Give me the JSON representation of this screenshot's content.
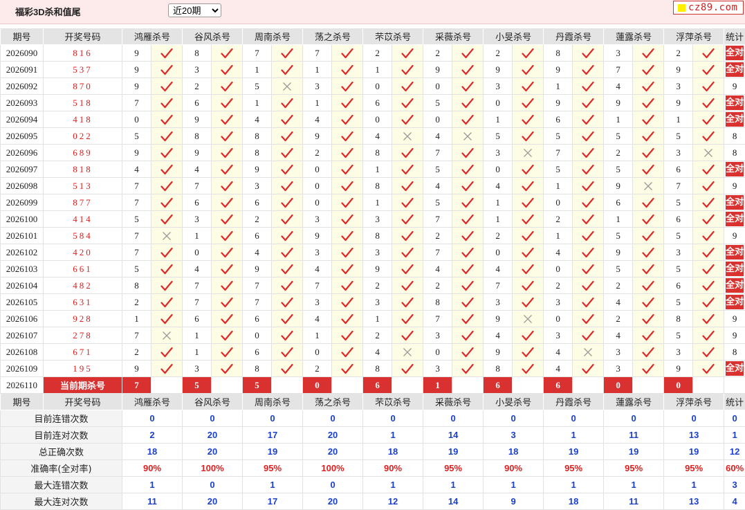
{
  "header": {
    "title": "福彩3D杀和值尾",
    "period_select": {
      "value": "近20期",
      "options": [
        "近20期"
      ]
    },
    "logo_text": "cz89.com"
  },
  "columns": {
    "issue": "期号",
    "winning": "开奖号码",
    "experts": [
      "鸿雁杀号",
      "谷风杀号",
      "周南杀号",
      "荡之杀号",
      "芣苡杀号",
      "采薇杀号",
      "小旻杀号",
      "丹霞杀号",
      "蓮露杀号",
      "浮萍杀号"
    ],
    "stat": "统计"
  },
  "rows": [
    {
      "issue": "2026090",
      "win": "816",
      "kills": [
        "9",
        "8",
        "7",
        "7",
        "2",
        "2",
        "2",
        "8",
        "3",
        "2"
      ],
      "ok": [
        1,
        1,
        1,
        1,
        1,
        1,
        1,
        1,
        1,
        1
      ],
      "stat": "全对"
    },
    {
      "issue": "2026091",
      "win": "537",
      "kills": [
        "9",
        "3",
        "1",
        "1",
        "1",
        "9",
        "9",
        "9",
        "7",
        "9"
      ],
      "ok": [
        1,
        1,
        1,
        1,
        1,
        1,
        1,
        1,
        1,
        1
      ],
      "stat": "全对"
    },
    {
      "issue": "2026092",
      "win": "870",
      "kills": [
        "9",
        "2",
        "5",
        "3",
        "0",
        "0",
        "3",
        "1",
        "4",
        "3"
      ],
      "ok": [
        1,
        1,
        0,
        1,
        1,
        1,
        1,
        1,
        1,
        1
      ],
      "stat": "9"
    },
    {
      "issue": "2026093",
      "win": "518",
      "kills": [
        "7",
        "6",
        "1",
        "1",
        "6",
        "5",
        "0",
        "9",
        "9",
        "9"
      ],
      "ok": [
        1,
        1,
        1,
        1,
        1,
        1,
        1,
        1,
        1,
        1
      ],
      "stat": "全对"
    },
    {
      "issue": "2026094",
      "win": "418",
      "kills": [
        "0",
        "9",
        "4",
        "4",
        "0",
        "0",
        "1",
        "6",
        "1",
        "1"
      ],
      "ok": [
        1,
        1,
        1,
        1,
        1,
        1,
        1,
        1,
        1,
        1
      ],
      "stat": "全对"
    },
    {
      "issue": "2026095",
      "win": "022",
      "kills": [
        "5",
        "8",
        "8",
        "9",
        "4",
        "4",
        "5",
        "5",
        "5",
        "5"
      ],
      "ok": [
        1,
        1,
        1,
        1,
        0,
        0,
        1,
        1,
        1,
        1
      ],
      "stat": "8"
    },
    {
      "issue": "2026096",
      "win": "689",
      "kills": [
        "9",
        "9",
        "8",
        "2",
        "8",
        "7",
        "3",
        "7",
        "2",
        "3"
      ],
      "ok": [
        1,
        1,
        1,
        1,
        1,
        1,
        0,
        1,
        1,
        0
      ],
      "stat": "8"
    },
    {
      "issue": "2026097",
      "win": "818",
      "kills": [
        "4",
        "4",
        "9",
        "0",
        "1",
        "5",
        "0",
        "5",
        "5",
        "6"
      ],
      "ok": [
        1,
        1,
        1,
        1,
        1,
        1,
        1,
        1,
        1,
        1
      ],
      "stat": "全对"
    },
    {
      "issue": "2026098",
      "win": "513",
      "kills": [
        "7",
        "7",
        "3",
        "0",
        "8",
        "4",
        "4",
        "1",
        "9",
        "7"
      ],
      "ok": [
        1,
        1,
        1,
        1,
        1,
        1,
        1,
        1,
        0,
        1
      ],
      "stat": "9"
    },
    {
      "issue": "2026099",
      "win": "877",
      "kills": [
        "7",
        "6",
        "6",
        "0",
        "1",
        "5",
        "1",
        "0",
        "6",
        "5"
      ],
      "ok": [
        1,
        1,
        1,
        1,
        1,
        1,
        1,
        1,
        1,
        1
      ],
      "stat": "全对"
    },
    {
      "issue": "2026100",
      "win": "414",
      "kills": [
        "5",
        "3",
        "2",
        "3",
        "3",
        "7",
        "1",
        "2",
        "1",
        "6"
      ],
      "ok": [
        1,
        1,
        1,
        1,
        1,
        1,
        1,
        1,
        1,
        1
      ],
      "stat": "全对"
    },
    {
      "issue": "2026101",
      "win": "584",
      "kills": [
        "7",
        "1",
        "6",
        "9",
        "8",
        "2",
        "2",
        "1",
        "5",
        "5"
      ],
      "ok": [
        0,
        1,
        1,
        1,
        1,
        1,
        1,
        1,
        1,
        1
      ],
      "stat": "9"
    },
    {
      "issue": "2026102",
      "win": "420",
      "kills": [
        "7",
        "0",
        "4",
        "3",
        "3",
        "7",
        "0",
        "4",
        "9",
        "3"
      ],
      "ok": [
        1,
        1,
        1,
        1,
        1,
        1,
        1,
        1,
        1,
        1
      ],
      "stat": "全对"
    },
    {
      "issue": "2026103",
      "win": "661",
      "kills": [
        "5",
        "4",
        "9",
        "4",
        "9",
        "4",
        "4",
        "0",
        "5",
        "5"
      ],
      "ok": [
        1,
        1,
        1,
        1,
        1,
        1,
        1,
        1,
        1,
        1
      ],
      "stat": "全对"
    },
    {
      "issue": "2026104",
      "win": "482",
      "kills": [
        "8",
        "7",
        "7",
        "7",
        "2",
        "2",
        "7",
        "2",
        "2",
        "6"
      ],
      "ok": [
        1,
        1,
        1,
        1,
        1,
        1,
        1,
        1,
        1,
        1
      ],
      "stat": "全对"
    },
    {
      "issue": "2026105",
      "win": "631",
      "kills": [
        "2",
        "7",
        "7",
        "3",
        "3",
        "8",
        "3",
        "3",
        "4",
        "5"
      ],
      "ok": [
        1,
        1,
        1,
        1,
        1,
        1,
        1,
        1,
        1,
        1
      ],
      "stat": "全对"
    },
    {
      "issue": "2026106",
      "win": "928",
      "kills": [
        "1",
        "6",
        "6",
        "4",
        "1",
        "7",
        "9",
        "0",
        "2",
        "8"
      ],
      "ok": [
        1,
        1,
        1,
        1,
        1,
        1,
        0,
        1,
        1,
        1
      ],
      "stat": "9"
    },
    {
      "issue": "2026107",
      "win": "278",
      "kills": [
        "7",
        "1",
        "0",
        "1",
        "2",
        "3",
        "4",
        "3",
        "4",
        "5"
      ],
      "ok": [
        0,
        1,
        1,
        1,
        1,
        1,
        1,
        1,
        1,
        1
      ],
      "stat": "9"
    },
    {
      "issue": "2026108",
      "win": "671",
      "kills": [
        "2",
        "1",
        "6",
        "0",
        "4",
        "0",
        "9",
        "4",
        "3",
        "3"
      ],
      "ok": [
        1,
        1,
        1,
        1,
        0,
        1,
        1,
        0,
        1,
        1
      ],
      "stat": "8"
    },
    {
      "issue": "2026109",
      "win": "195",
      "kills": [
        "9",
        "3",
        "8",
        "2",
        "8",
        "3",
        "8",
        "4",
        "3",
        "9"
      ],
      "ok": [
        1,
        1,
        1,
        1,
        1,
        1,
        1,
        1,
        1,
        1
      ],
      "stat": "全对"
    }
  ],
  "current": {
    "issue": "2026110",
    "label": "当前期杀号",
    "kills": [
      "7",
      "5",
      "5",
      "0",
      "6",
      "1",
      "6",
      "6",
      "0",
      "0"
    ]
  },
  "summary": {
    "header": {
      "issue": "期号",
      "winning": "开奖号码",
      "stat": "统计"
    },
    "rows": [
      {
        "label": "目前连错次数",
        "values": [
          "0",
          "0",
          "0",
          "0",
          "0",
          "0",
          "0",
          "0",
          "0",
          "0"
        ],
        "stat": "0",
        "color": "blue"
      },
      {
        "label": "目前连对次数",
        "values": [
          "2",
          "20",
          "17",
          "20",
          "1",
          "14",
          "3",
          "1",
          "11",
          "13"
        ],
        "stat": "1",
        "color": "blue"
      },
      {
        "label": "总正确次数",
        "values": [
          "18",
          "20",
          "19",
          "20",
          "18",
          "19",
          "18",
          "19",
          "19",
          "19"
        ],
        "stat": "12",
        "color": "blue"
      },
      {
        "label": "准确率(全对率)",
        "values": [
          "90%",
          "100%",
          "95%",
          "100%",
          "90%",
          "95%",
          "90%",
          "95%",
          "95%",
          "95%"
        ],
        "stat": "60%",
        "color": "red"
      },
      {
        "label": "最大连错次数",
        "values": [
          "1",
          "0",
          "1",
          "0",
          "1",
          "1",
          "1",
          "1",
          "1",
          "1"
        ],
        "stat": "3",
        "color": "blue"
      },
      {
        "label": "最大连对次数",
        "values": [
          "11",
          "20",
          "17",
          "20",
          "12",
          "14",
          "9",
          "18",
          "11",
          "13"
        ],
        "stat": "4",
        "color": "blue"
      }
    ]
  },
  "colors": {
    "check": "#e02828",
    "cross": "#999999",
    "accent": "#d93030",
    "blue": "#1a3fcc"
  }
}
